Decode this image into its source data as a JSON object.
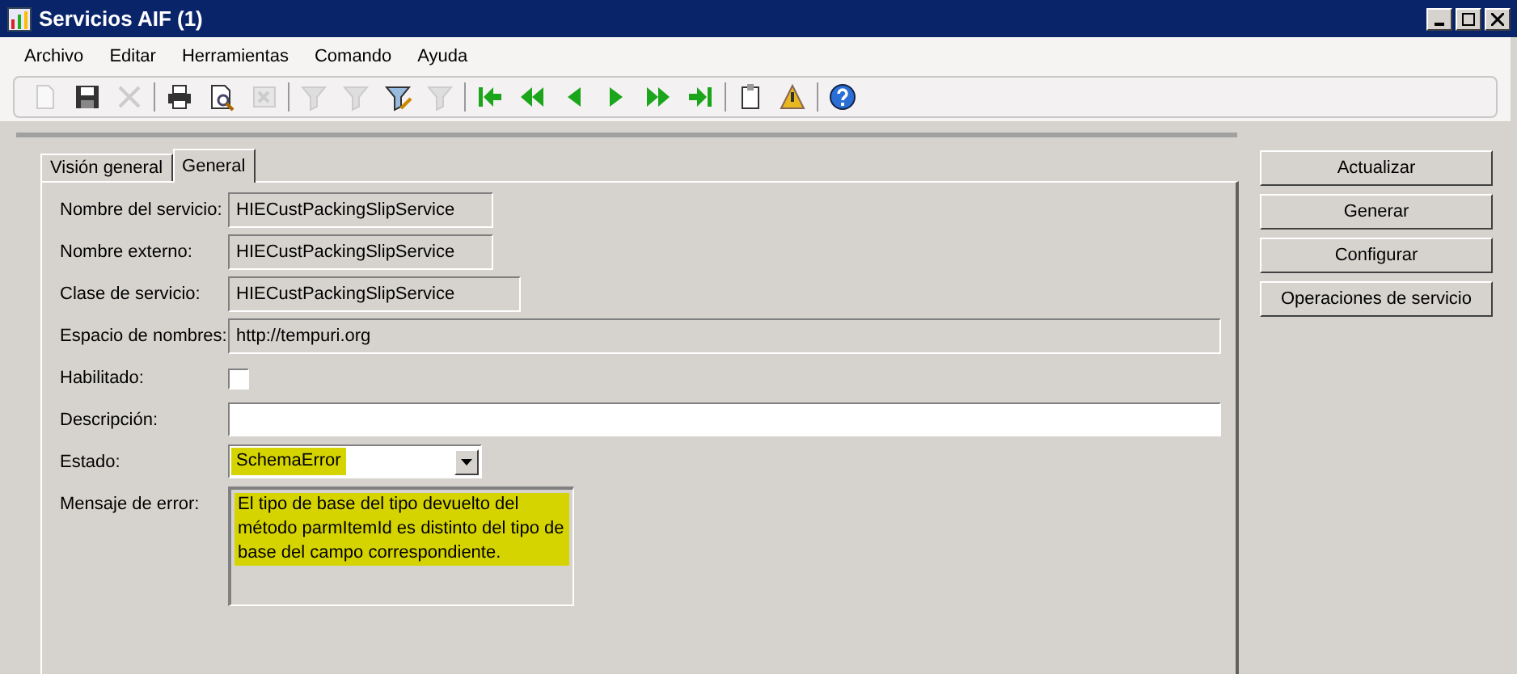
{
  "window": {
    "title": "Servicios AIF (1)"
  },
  "menu": [
    "Archivo",
    "Editar",
    "Herramientas",
    "Comando",
    "Ayuda"
  ],
  "toolbar": {
    "groups": [
      {
        "items": [
          {
            "kind": "new",
            "disabled": true
          },
          {
            "kind": "save",
            "disabled": false
          },
          {
            "kind": "delete",
            "disabled": true
          }
        ]
      },
      {
        "items": [
          {
            "kind": "print",
            "disabled": false
          },
          {
            "kind": "preview",
            "disabled": false
          },
          {
            "kind": "excel",
            "disabled": true
          }
        ]
      },
      {
        "items": [
          {
            "kind": "filter",
            "disabled": true
          },
          {
            "kind": "filter-grid",
            "disabled": true
          },
          {
            "kind": "filter-edit",
            "disabled": false
          },
          {
            "kind": "filter-clear",
            "disabled": true
          }
        ]
      },
      {
        "items": [
          {
            "kind": "first",
            "disabled": false
          },
          {
            "kind": "prev-page",
            "disabled": false
          },
          {
            "kind": "prev",
            "disabled": false
          },
          {
            "kind": "next",
            "disabled": false
          },
          {
            "kind": "next-page",
            "disabled": false
          },
          {
            "kind": "last",
            "disabled": false
          }
        ]
      },
      {
        "items": [
          {
            "kind": "attach",
            "disabled": false
          },
          {
            "kind": "alert",
            "disabled": false
          }
        ]
      },
      {
        "items": [
          {
            "kind": "help",
            "disabled": false
          }
        ]
      }
    ]
  },
  "tabs": [
    {
      "label": "Visión general",
      "selected": false
    },
    {
      "label": "General",
      "selected": true
    }
  ],
  "fields": [
    {
      "kind": "text",
      "label": "Nombre del servicio:",
      "value": "HIECustPackingSlipService"
    },
    {
      "kind": "text",
      "label": "Nombre externo:",
      "value": "HIECustPackingSlipService"
    },
    {
      "kind": "text",
      "label": "Clase de servicio:",
      "value": "HIECustPackingSlipService"
    },
    {
      "kind": "text",
      "label": "Espacio de nombres:",
      "value": "http://tempuri.org"
    },
    {
      "kind": "checkbox",
      "label": "Habilitado:",
      "checked": false
    },
    {
      "kind": "input",
      "label": "Descripción:"
    },
    {
      "kind": "combo",
      "label": "Estado:",
      "value": "SchemaError",
      "highlighted": true
    },
    {
      "kind": "memo",
      "label": "Mensaje de error:",
      "value": "El tipo de base del tipo devuelto del método parmItemId es distinto del tipo de base del campo correspondiente.",
      "highlighted": true
    }
  ],
  "buttons": [
    "Actualizar",
    "Generar",
    "Configurar",
    "Operaciones de servicio"
  ]
}
